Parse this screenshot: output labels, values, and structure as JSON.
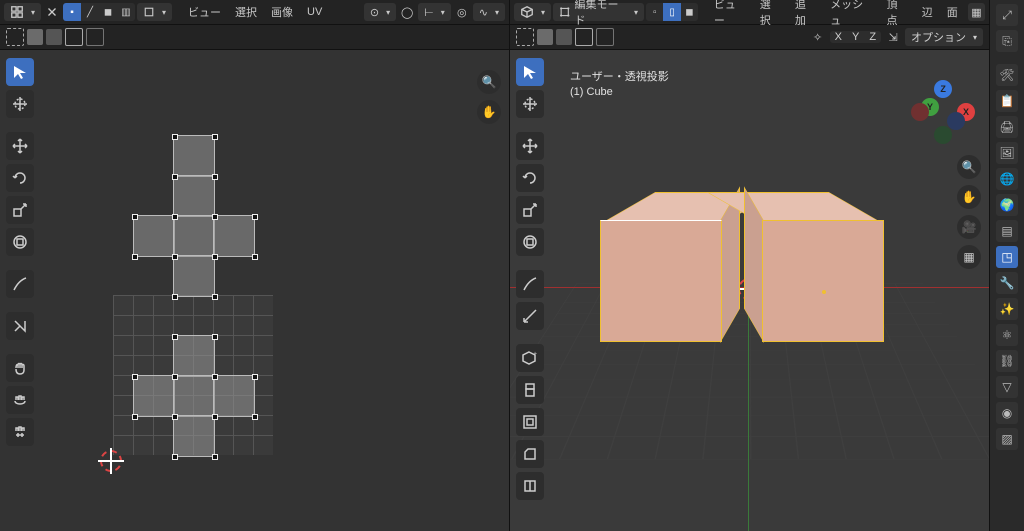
{
  "uv_header": {
    "menu": {
      "view": "ビュー",
      "select": "選択",
      "image": "画像",
      "uv": "UV"
    }
  },
  "v3d_header": {
    "mode_label": "編集モード",
    "menu": {
      "view": "ビュー",
      "select": "選択",
      "add": "追加",
      "mesh": "メッシュ",
      "vertex": "頂点",
      "edge": "辺",
      "face": "面"
    }
  },
  "v3d_subheader": {
    "axis": {
      "x": "X",
      "y": "Y",
      "z": "Z"
    },
    "options_label": "オプション"
  },
  "overlay": {
    "line1": "ユーザー・透視投影",
    "line2": "(1) Cube"
  },
  "gizmo": {
    "x": "X",
    "y": "Y",
    "z": "Z"
  },
  "floating_buttons": {
    "zoom": "🔍",
    "pan": "✋",
    "camera": "🎥",
    "persp": "▦"
  },
  "right_panel_icons": [
    "⤢",
    "⎘",
    "",
    "🛠",
    "📋",
    "🖨",
    "🖼",
    "🌐",
    "◳",
    "🌍",
    "▤",
    "◧",
    "🔧",
    "⚛",
    "⛓",
    "✨",
    "🧵"
  ]
}
